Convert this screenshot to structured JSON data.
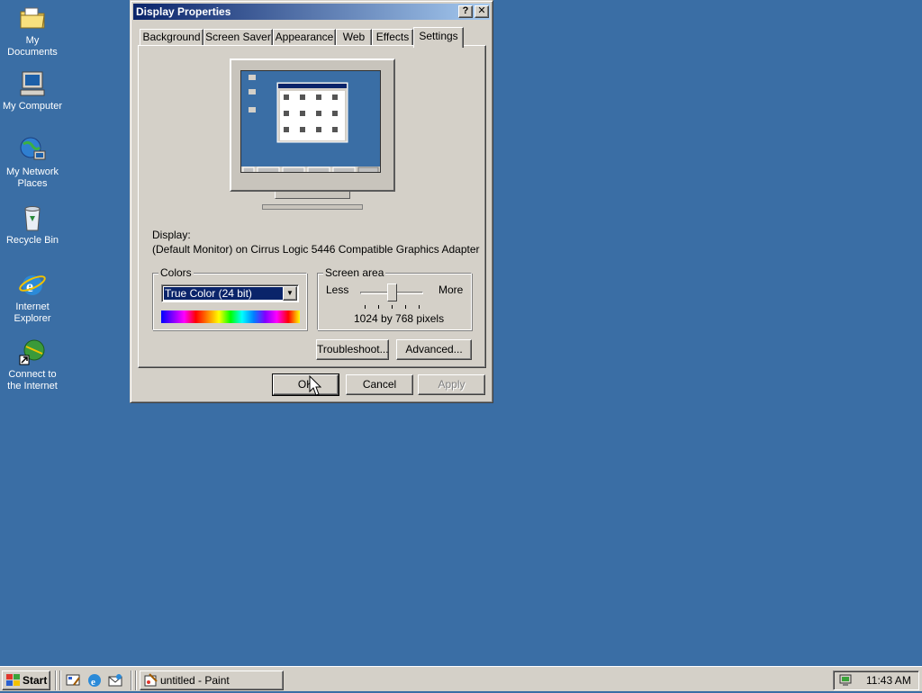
{
  "desktop": {
    "icons": [
      {
        "label": "My Documents",
        "icon": "folder-documents-icon"
      },
      {
        "label": "My Computer",
        "icon": "computer-icon"
      },
      {
        "label": "My Network Places",
        "icon": "network-places-icon"
      },
      {
        "label": "Recycle Bin",
        "icon": "recycle-bin-icon"
      },
      {
        "label": "Internet Explorer",
        "icon": "internet-explorer-icon"
      },
      {
        "label": "Connect to the Internet",
        "icon": "connect-internet-icon"
      }
    ]
  },
  "dialog": {
    "title": "Display Properties",
    "help_glyph": "?",
    "close_glyph": "✕",
    "tabs": [
      "Background",
      "Screen Saver",
      "Appearance",
      "Web",
      "Effects",
      "Settings"
    ],
    "active_tab": "Settings",
    "display_label": "Display:",
    "display_value": "(Default Monitor) on Cirrus Logic 5446 Compatible Graphics Adapter",
    "colors": {
      "legend": "Colors",
      "selected": "True Color (24 bit)"
    },
    "screen_area": {
      "legend": "Screen area",
      "less_label": "Less",
      "more_label": "More",
      "value_text": "1024 by 768 pixels",
      "slider_position": 0.5
    },
    "buttons": {
      "troubleshoot": "Troubleshoot...",
      "advanced": "Advanced...",
      "ok": "OK",
      "cancel": "Cancel",
      "apply": "Apply"
    }
  },
  "taskbar": {
    "start_label": "Start",
    "quick_launch": [
      "show-desktop-icon",
      "internet-explorer-icon",
      "outlook-express-icon"
    ],
    "task_label": "untitled - Paint",
    "clock": "11:43 AM"
  },
  "colors": {
    "desktop": "#3a6ea5",
    "title_active_start": "#0a246a",
    "title_active_end": "#a6caf0",
    "face": "#d4d0c8"
  }
}
